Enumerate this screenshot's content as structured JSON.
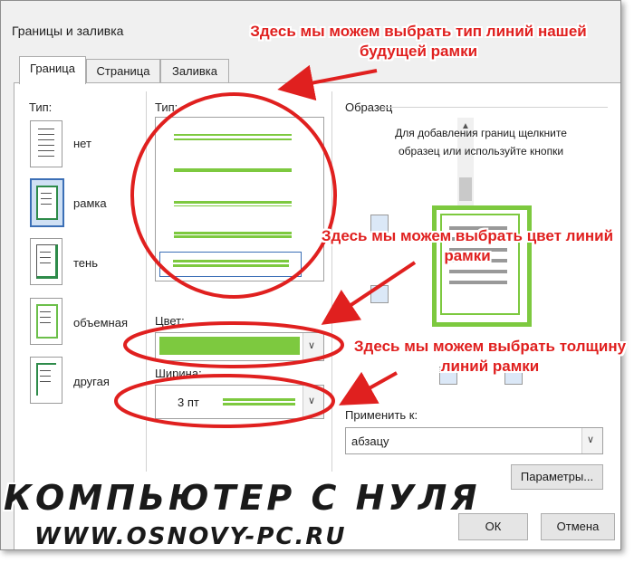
{
  "dialog": {
    "title": "Границы и заливка"
  },
  "tabs": [
    {
      "label": "Граница",
      "active": true
    },
    {
      "label": "Страница",
      "active": false
    },
    {
      "label": "Заливка",
      "active": false
    }
  ],
  "left": {
    "type_label": "Тип:",
    "settings": [
      {
        "label": "нет",
        "selected": false
      },
      {
        "label": "рамка",
        "selected": true
      },
      {
        "label": "тень",
        "selected": false
      },
      {
        "label": "объемная",
        "selected": false
      },
      {
        "label": "другая",
        "selected": false
      }
    ]
  },
  "middle": {
    "type_label": "Тип:",
    "color_label": "Цвет:",
    "width_label": "Ширина:",
    "width_value": "3 пт",
    "color_value_hex": "#7dc93f"
  },
  "preview": {
    "label": "Образец",
    "hint": "Для добавления границ щелкните образец или используйте кнопки"
  },
  "apply": {
    "label": "Применить к:",
    "value": "абзацу",
    "params_button": "Параметры..."
  },
  "buttons": {
    "ok": "ОК",
    "cancel": "Отмена"
  },
  "callouts": [
    "Здесь мы можем выбрать тип линий нашей будущей рамки",
    "Здесь мы можем выбрать цвет линий рамки",
    "Здесь мы можем выбрать толщину линий рамки"
  ],
  "watermark": {
    "line1": "КОМПЬЮТЕР С НУЛЯ",
    "line2": "WWW.OSNOVY-PC.RU"
  },
  "colors": {
    "accent_green": "#7dc93f",
    "annotation_red": "#e0201f",
    "selection_blue": "#3b6fb6"
  }
}
